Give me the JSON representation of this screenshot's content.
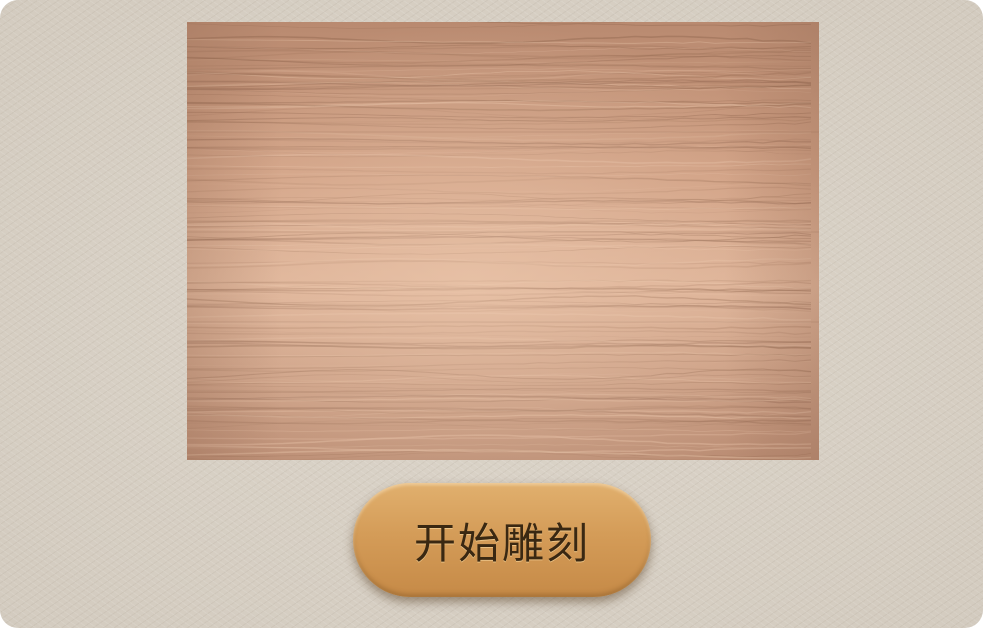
{
  "app": {
    "background_color": "#d8d1c6"
  },
  "board": {
    "icon": "wood-texture-image",
    "base_color": "#c89a7f",
    "light_color": "#e2bda2",
    "dark_color": "#a87c64"
  },
  "action": {
    "label": "开始雕刻",
    "icon": "none",
    "color": "#d49c58"
  }
}
